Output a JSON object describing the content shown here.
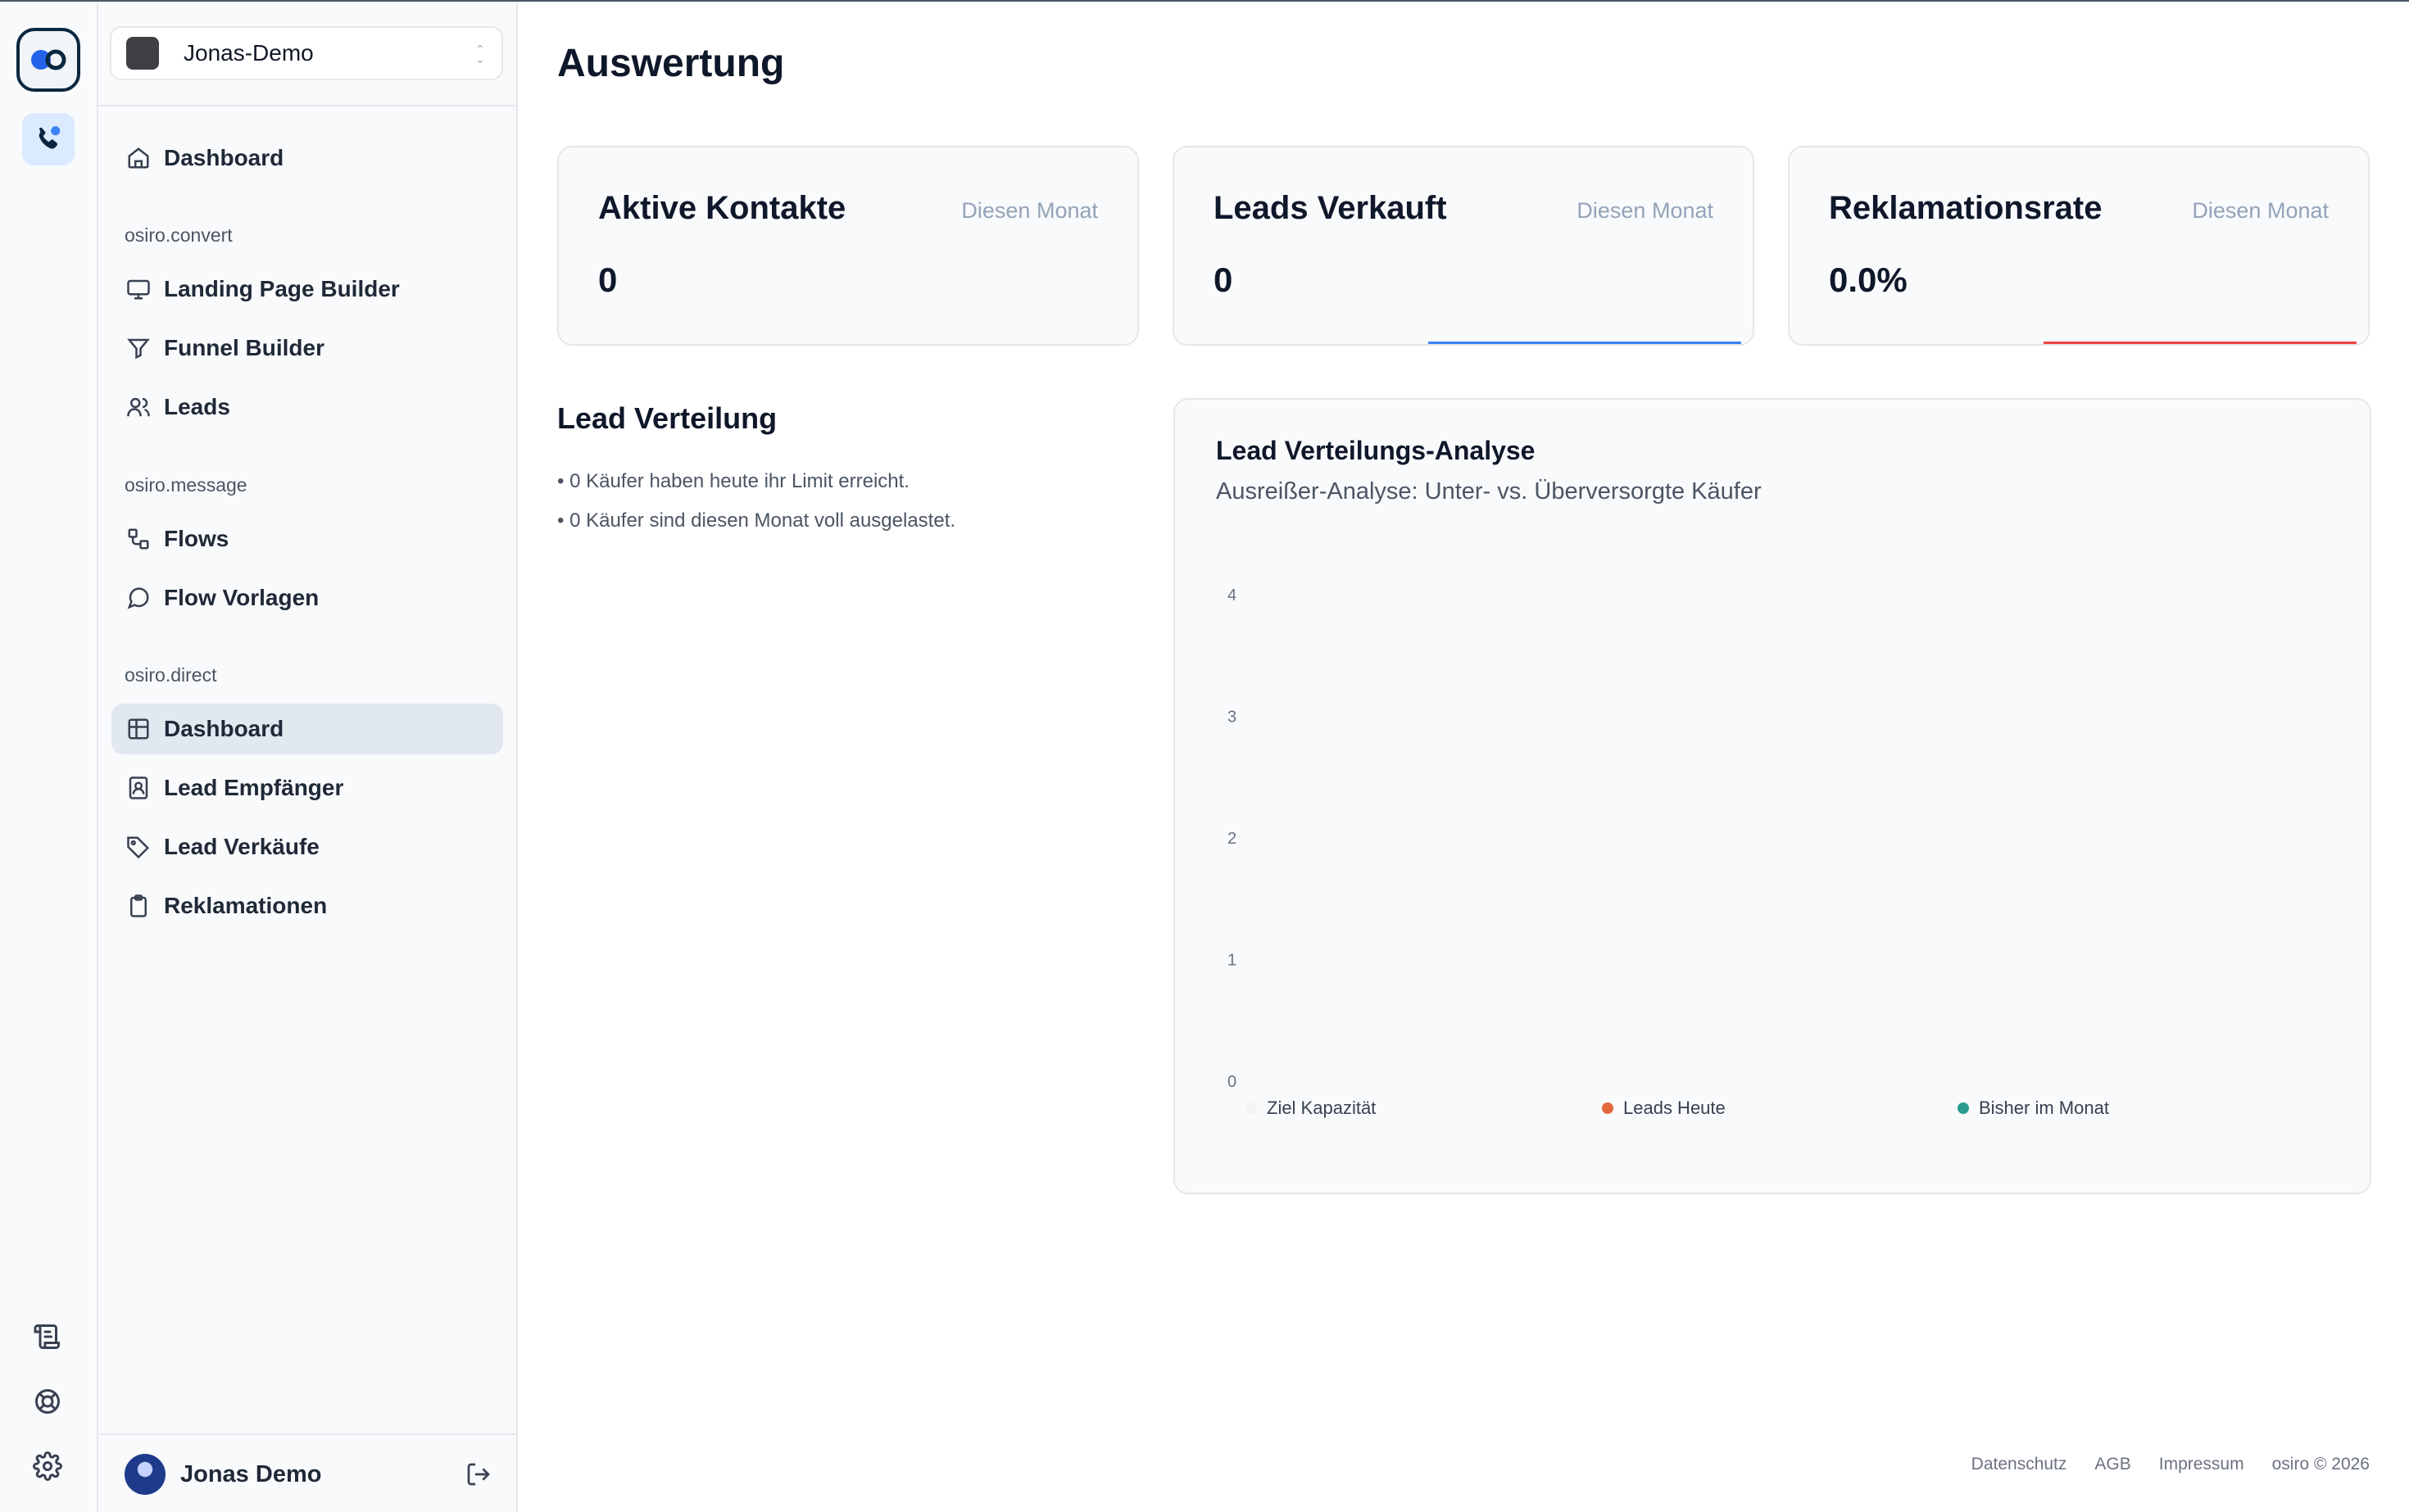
{
  "app": {
    "workspace": "Jonas-Demo",
    "workspace_chevron": "⌃⌄",
    "page_title": "Auswertung"
  },
  "sidebar": {
    "top_item": "Dashboard",
    "sections": [
      {
        "label": "osiro.convert",
        "items": [
          "Landing Page Builder",
          "Funnel Builder",
          "Leads"
        ]
      },
      {
        "label": "osiro.message",
        "items": [
          "Flows",
          "Flow Vorlagen"
        ]
      },
      {
        "label": "osiro.direct",
        "items": [
          "Dashboard",
          "Lead Empfänger",
          "Lead Verkäufe",
          "Reklamationen"
        ]
      }
    ],
    "active_item": "osiro.direct / Dashboard",
    "user_name": "Jonas Demo"
  },
  "cards": [
    {
      "title": "Aktive Kontakte",
      "period": "Diesen Monat",
      "value": "0"
    },
    {
      "title": "Leads Verkauft",
      "period": "Diesen Monat",
      "value": "0"
    },
    {
      "title": "Reklamationsrate",
      "period": "Diesen Monat",
      "value": "0.0%"
    }
  ],
  "distribution": {
    "title": "Lead Verteilung",
    "bullets": [
      "• 0 Käufer haben heute ihr Limit erreicht.",
      "• 0 Käufer sind diesen Monat voll ausgelastet."
    ]
  },
  "chart_data": {
    "type": "bar",
    "title": "Lead Verteilungs-Analyse",
    "subtitle": "Ausreißer-Analyse: Unter- vs. Überversorgte Käufer",
    "categories": [],
    "series": [
      {
        "name": "Ziel Kapazität",
        "values": []
      },
      {
        "name": "Leads Heute",
        "values": []
      },
      {
        "name": "Bisher im Monat",
        "values": []
      }
    ],
    "yticks": [
      0,
      1,
      2,
      3,
      4
    ],
    "ylim": [
      0,
      4
    ],
    "grid": false,
    "legend_position": "bottom"
  },
  "colors": {
    "accent_blue": "#3b82f6",
    "accent_red": "#ef4444",
    "ziel_kapazitaet": "#f3f4f6",
    "leads_heute": "#e2683c",
    "bisher_im_monat": "#2a9d8f"
  },
  "footer": {
    "links": [
      "Datenschutz",
      "AGB",
      "Impressum"
    ],
    "copyright": "osiro © 2026"
  }
}
